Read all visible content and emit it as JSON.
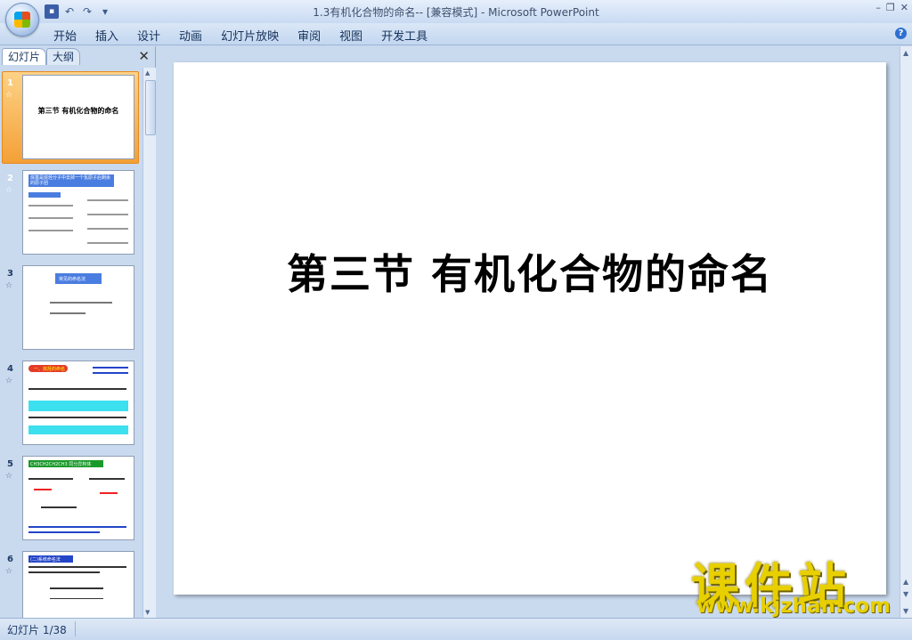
{
  "window": {
    "title": "1.3有机化合物的命名-- [兼容模式] - Microsoft PowerPoint"
  },
  "quick_access": {
    "icons": [
      "save-icon",
      "undo-icon",
      "redo-icon",
      "customize-icon"
    ]
  },
  "ribbon": {
    "tabs": [
      {
        "label": "开始"
      },
      {
        "label": "插入"
      },
      {
        "label": "设计"
      },
      {
        "label": "动画"
      },
      {
        "label": "幻灯片放映"
      },
      {
        "label": "审阅"
      },
      {
        "label": "视图"
      },
      {
        "label": "开发工具"
      }
    ]
  },
  "pane": {
    "tab_slides": "幻灯片",
    "tab_outline": "大纲",
    "close": "✕",
    "thumbnails": [
      {
        "number": "1",
        "title": "第三节  有机化合物的命名"
      },
      {
        "number": "2",
        "header": "烷基是烷烃分子中去掉一个氢原子后剩余的原子团"
      },
      {
        "number": "3",
        "header": "常见的命名法"
      },
      {
        "number": "4",
        "header": "一、烷烃的命名"
      },
      {
        "number": "5",
        "header": "CH3CH2CH2CH3 同分异构体"
      },
      {
        "number": "6",
        "header": "(二)系统命名法"
      }
    ]
  },
  "slide": {
    "title": "第三节  有机化合物的命名"
  },
  "watermark": {
    "title": "课件站",
    "url": "www.kjzhan.com"
  },
  "status": {
    "slide_counter": "幻灯片 1/38"
  }
}
